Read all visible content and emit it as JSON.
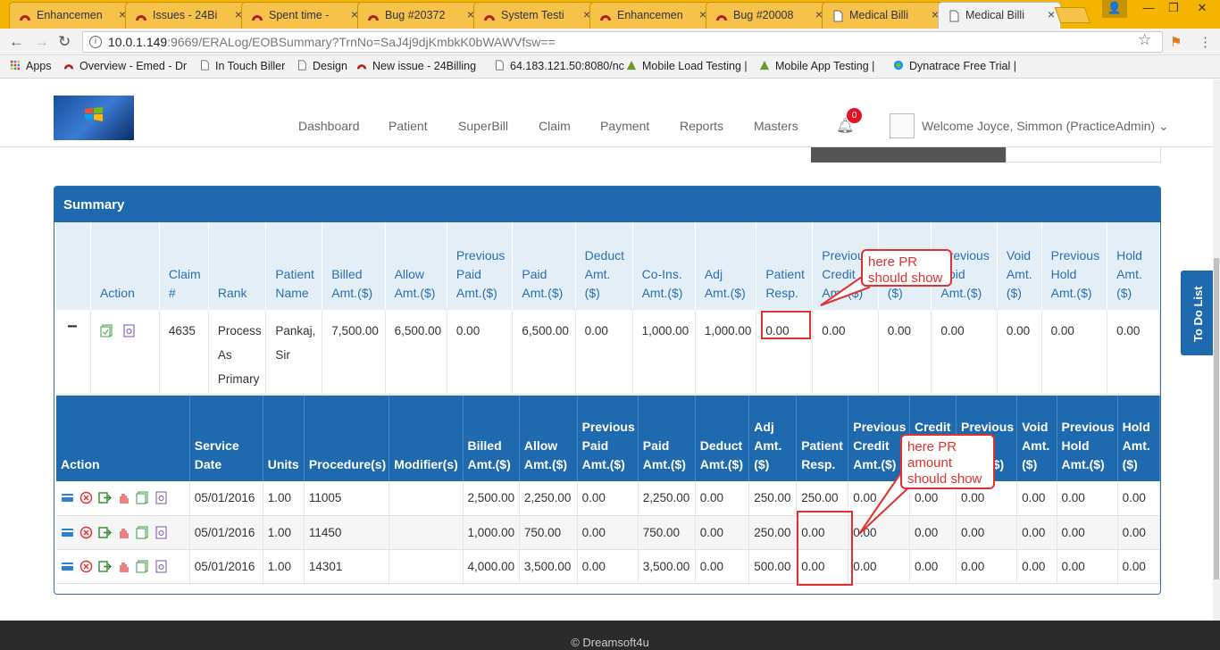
{
  "browser": {
    "tabs": [
      {
        "title": "Enhancemen",
        "icon": "redmine-icon",
        "active": false
      },
      {
        "title": "Issues - 24Bi",
        "icon": "redmine-icon",
        "active": false
      },
      {
        "title": "Spent time -",
        "icon": "redmine-icon",
        "active": false
      },
      {
        "title": "Bug #20372",
        "icon": "redmine-icon",
        "active": false
      },
      {
        "title": "System Testi",
        "icon": "redmine-icon",
        "active": false
      },
      {
        "title": "Enhancemen",
        "icon": "redmine-icon",
        "active": false
      },
      {
        "title": "Bug #20008",
        "icon": "redmine-icon",
        "active": false
      },
      {
        "title": "Medical Billi",
        "icon": "page-icon",
        "active": false
      },
      {
        "title": "Medical Billi",
        "icon": "page-icon",
        "active": true
      }
    ],
    "url_host": "10.0.1.149",
    "url_path": ":9669/ERALog/EOBSummary?TrnNo=SaJ4j9djKmbkK0bWAWVfsw==",
    "bookmarks": [
      {
        "label": "Apps",
        "icon": "apps-grid-icon"
      },
      {
        "label": "Overview - Emed - Dr",
        "icon": "redmine-icon"
      },
      {
        "label": "In Touch Biller",
        "icon": "page-icon"
      },
      {
        "label": "Design",
        "icon": "page-icon"
      },
      {
        "label": "New issue - 24Billing",
        "icon": "redmine-icon"
      },
      {
        "label": "64.183.121.50:8080/nc",
        "icon": "page-icon"
      },
      {
        "label": "Mobile Load Testing |",
        "icon": "triangle-icon"
      },
      {
        "label": "Mobile App Testing |",
        "icon": "triangle-icon"
      },
      {
        "label": "Dynatrace Free Trial |",
        "icon": "dynatrace-icon"
      }
    ]
  },
  "header": {
    "nav": [
      "Dashboard",
      "Patient",
      "SuperBill",
      "Claim",
      "Payment",
      "Reports",
      "Masters"
    ],
    "notification_count": "0",
    "welcome": "Welcome  Joyce, Simmon (PracticeAdmin)"
  },
  "summary": {
    "title": "Summary",
    "claim_headers": [
      "",
      "Action",
      "Claim #",
      "Rank",
      "Patient Name",
      "Billed Amt.($)",
      "Allow Amt.($)",
      "Previous Paid Amt.($)",
      "Paid Amt.($)",
      "Deduct Amt.($)",
      "Co-Ins. Amt.($)",
      "Adj Amt.($)",
      "Patient Resp.",
      "Previous Credit Amt.($)",
      "Credit Amt.($)",
      "Previous Void Amt.($)",
      "Void Amt.($)",
      "Previous Hold Amt.($)",
      "Hold Amt.($)"
    ],
    "claim_row": {
      "collapse": "−",
      "claim_no": "4635",
      "rank": "Process As Primary",
      "patient": "Pankaj, Sir",
      "billed": "7,500.00",
      "allow": "6,500.00",
      "prev_paid": "0.00",
      "paid": "6,500.00",
      "deduct": "0.00",
      "coins": "1,000.00",
      "adj": "1,000.00",
      "patient_resp": "0.00",
      "prev_credit": "0.00",
      "credit": "0.00",
      "prev_void": "0.00",
      "void": "0.00",
      "prev_hold": "0.00",
      "hold": "0.00"
    },
    "line_headers": [
      "Action",
      "Service Date",
      "Units",
      "Procedure(s)",
      "Modifier(s)",
      "Billed Amt.($)",
      "Allow Amt.($)",
      "Previous Paid Amt.($)",
      "Paid Amt.($)",
      "Deduct Amt.($)",
      "Adj Amt. ($)",
      "Patient Resp.",
      "Previous Credit Amt.($)",
      "Credit Amt.($)",
      "Previous Void Amt.($)",
      "Void Amt. ($)",
      "Previous Hold Amt.($)",
      "Hold Amt. ($)"
    ],
    "lines": [
      [
        "05/01/2016",
        "1.00",
        "11005",
        "",
        "2,500.00",
        "2,250.00",
        "0.00",
        "2,250.00",
        "0.00",
        "250.00",
        "250.00",
        "0.00",
        "0.00",
        "0.00",
        "0.00",
        "0.00",
        "0.00"
      ],
      [
        "05/01/2016",
        "1.00",
        "11450",
        "",
        "1,000.00",
        "750.00",
        "0.00",
        "750.00",
        "0.00",
        "250.00",
        "0.00",
        "0.00",
        "0.00",
        "0.00",
        "0.00",
        "0.00",
        "0.00"
      ],
      [
        "05/01/2016",
        "1.00",
        "14301",
        "",
        "4,000.00",
        "3,500.00",
        "0.00",
        "3,500.00",
        "0.00",
        "500.00",
        "0.00",
        "0.00",
        "0.00",
        "0.00",
        "0.00",
        "0.00",
        "0.00"
      ]
    ]
  },
  "annotations": {
    "callout1": "here PR should show",
    "callout2": "here PR amount should show"
  },
  "todo_label": "To Do List",
  "footer": "© Dreamsoft4u",
  "colors": {
    "primary": "#1f6aaf",
    "annotation": "#e03030",
    "tab_strip": "#f4b400"
  }
}
